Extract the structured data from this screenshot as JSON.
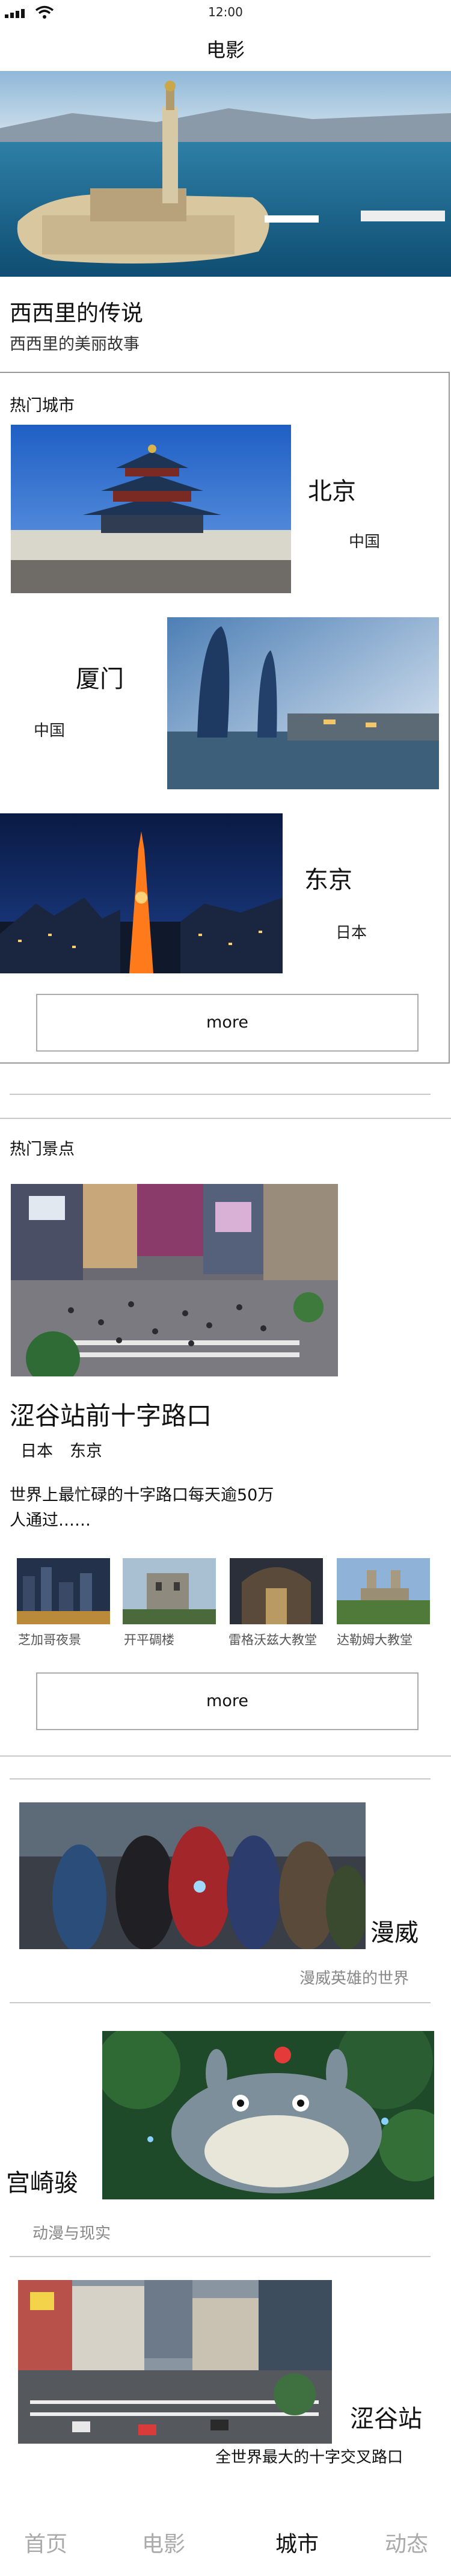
{
  "status_bar": {
    "time": "12:00"
  },
  "nav": {
    "title": "电影"
  },
  "hero": {
    "title": "西西里的传说",
    "subtitle": "西西里的美丽故事"
  },
  "hot_cities": {
    "label": "热门城市",
    "items": [
      {
        "name": "北京",
        "country": "中国"
      },
      {
        "name": "厦门",
        "country": "中国"
      },
      {
        "name": "东京",
        "country": "日本"
      }
    ],
    "more_label": "more"
  },
  "hot_spots": {
    "label": "热门景点",
    "title": "涩谷站前十字路口",
    "country": "日本",
    "city": "东京",
    "description": "世界上最忙碌的十字路口每天逾50万人通过……",
    "thumbnails": [
      {
        "label": "芝加哥夜景"
      },
      {
        "label": "开平碉楼"
      },
      {
        "label": "雷格沃兹大教堂"
      },
      {
        "label": "达勒姆大教堂"
      }
    ],
    "more_label": "more"
  },
  "promos": [
    {
      "name": "漫威",
      "subtitle": "漫威英雄的世界"
    },
    {
      "name": "宫崎骏",
      "subtitle": "动漫与现实"
    },
    {
      "name": "涩谷站",
      "subtitle": "全世界最大的十字交叉路口"
    }
  ],
  "tabbar": {
    "tabs": [
      {
        "label": "首页"
      },
      {
        "label": "电影"
      },
      {
        "label": "城市",
        "active": true
      },
      {
        "label": "动态"
      }
    ]
  }
}
